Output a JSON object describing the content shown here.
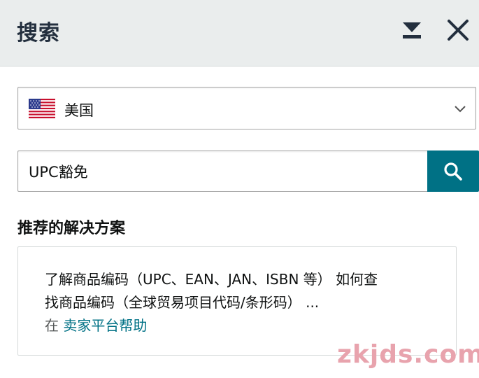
{
  "header": {
    "title": "搜索"
  },
  "country_select": {
    "label": "美国"
  },
  "search": {
    "value": "UPC豁免"
  },
  "recommended": {
    "title": "推荐的解决方案",
    "results": [
      {
        "text_line1": "了解商品编码（UPC、EAN、JAN、ISBN 等） 如何查",
        "text_line2": "找商品编码（全球贸易项目代码/条形码） ...",
        "source_prefix": "在 ",
        "source_link": "卖家平台帮助"
      }
    ]
  },
  "watermark": "zkjds.com",
  "colors": {
    "header_bg": "#eaeded",
    "accent": "#007185",
    "border": "#a6a6a6"
  },
  "icons": {
    "minimize": "minimize-panel-icon",
    "close": "close-icon",
    "flag": "us-flag-icon",
    "chevron": "chevron-down-icon",
    "search": "search-icon"
  }
}
